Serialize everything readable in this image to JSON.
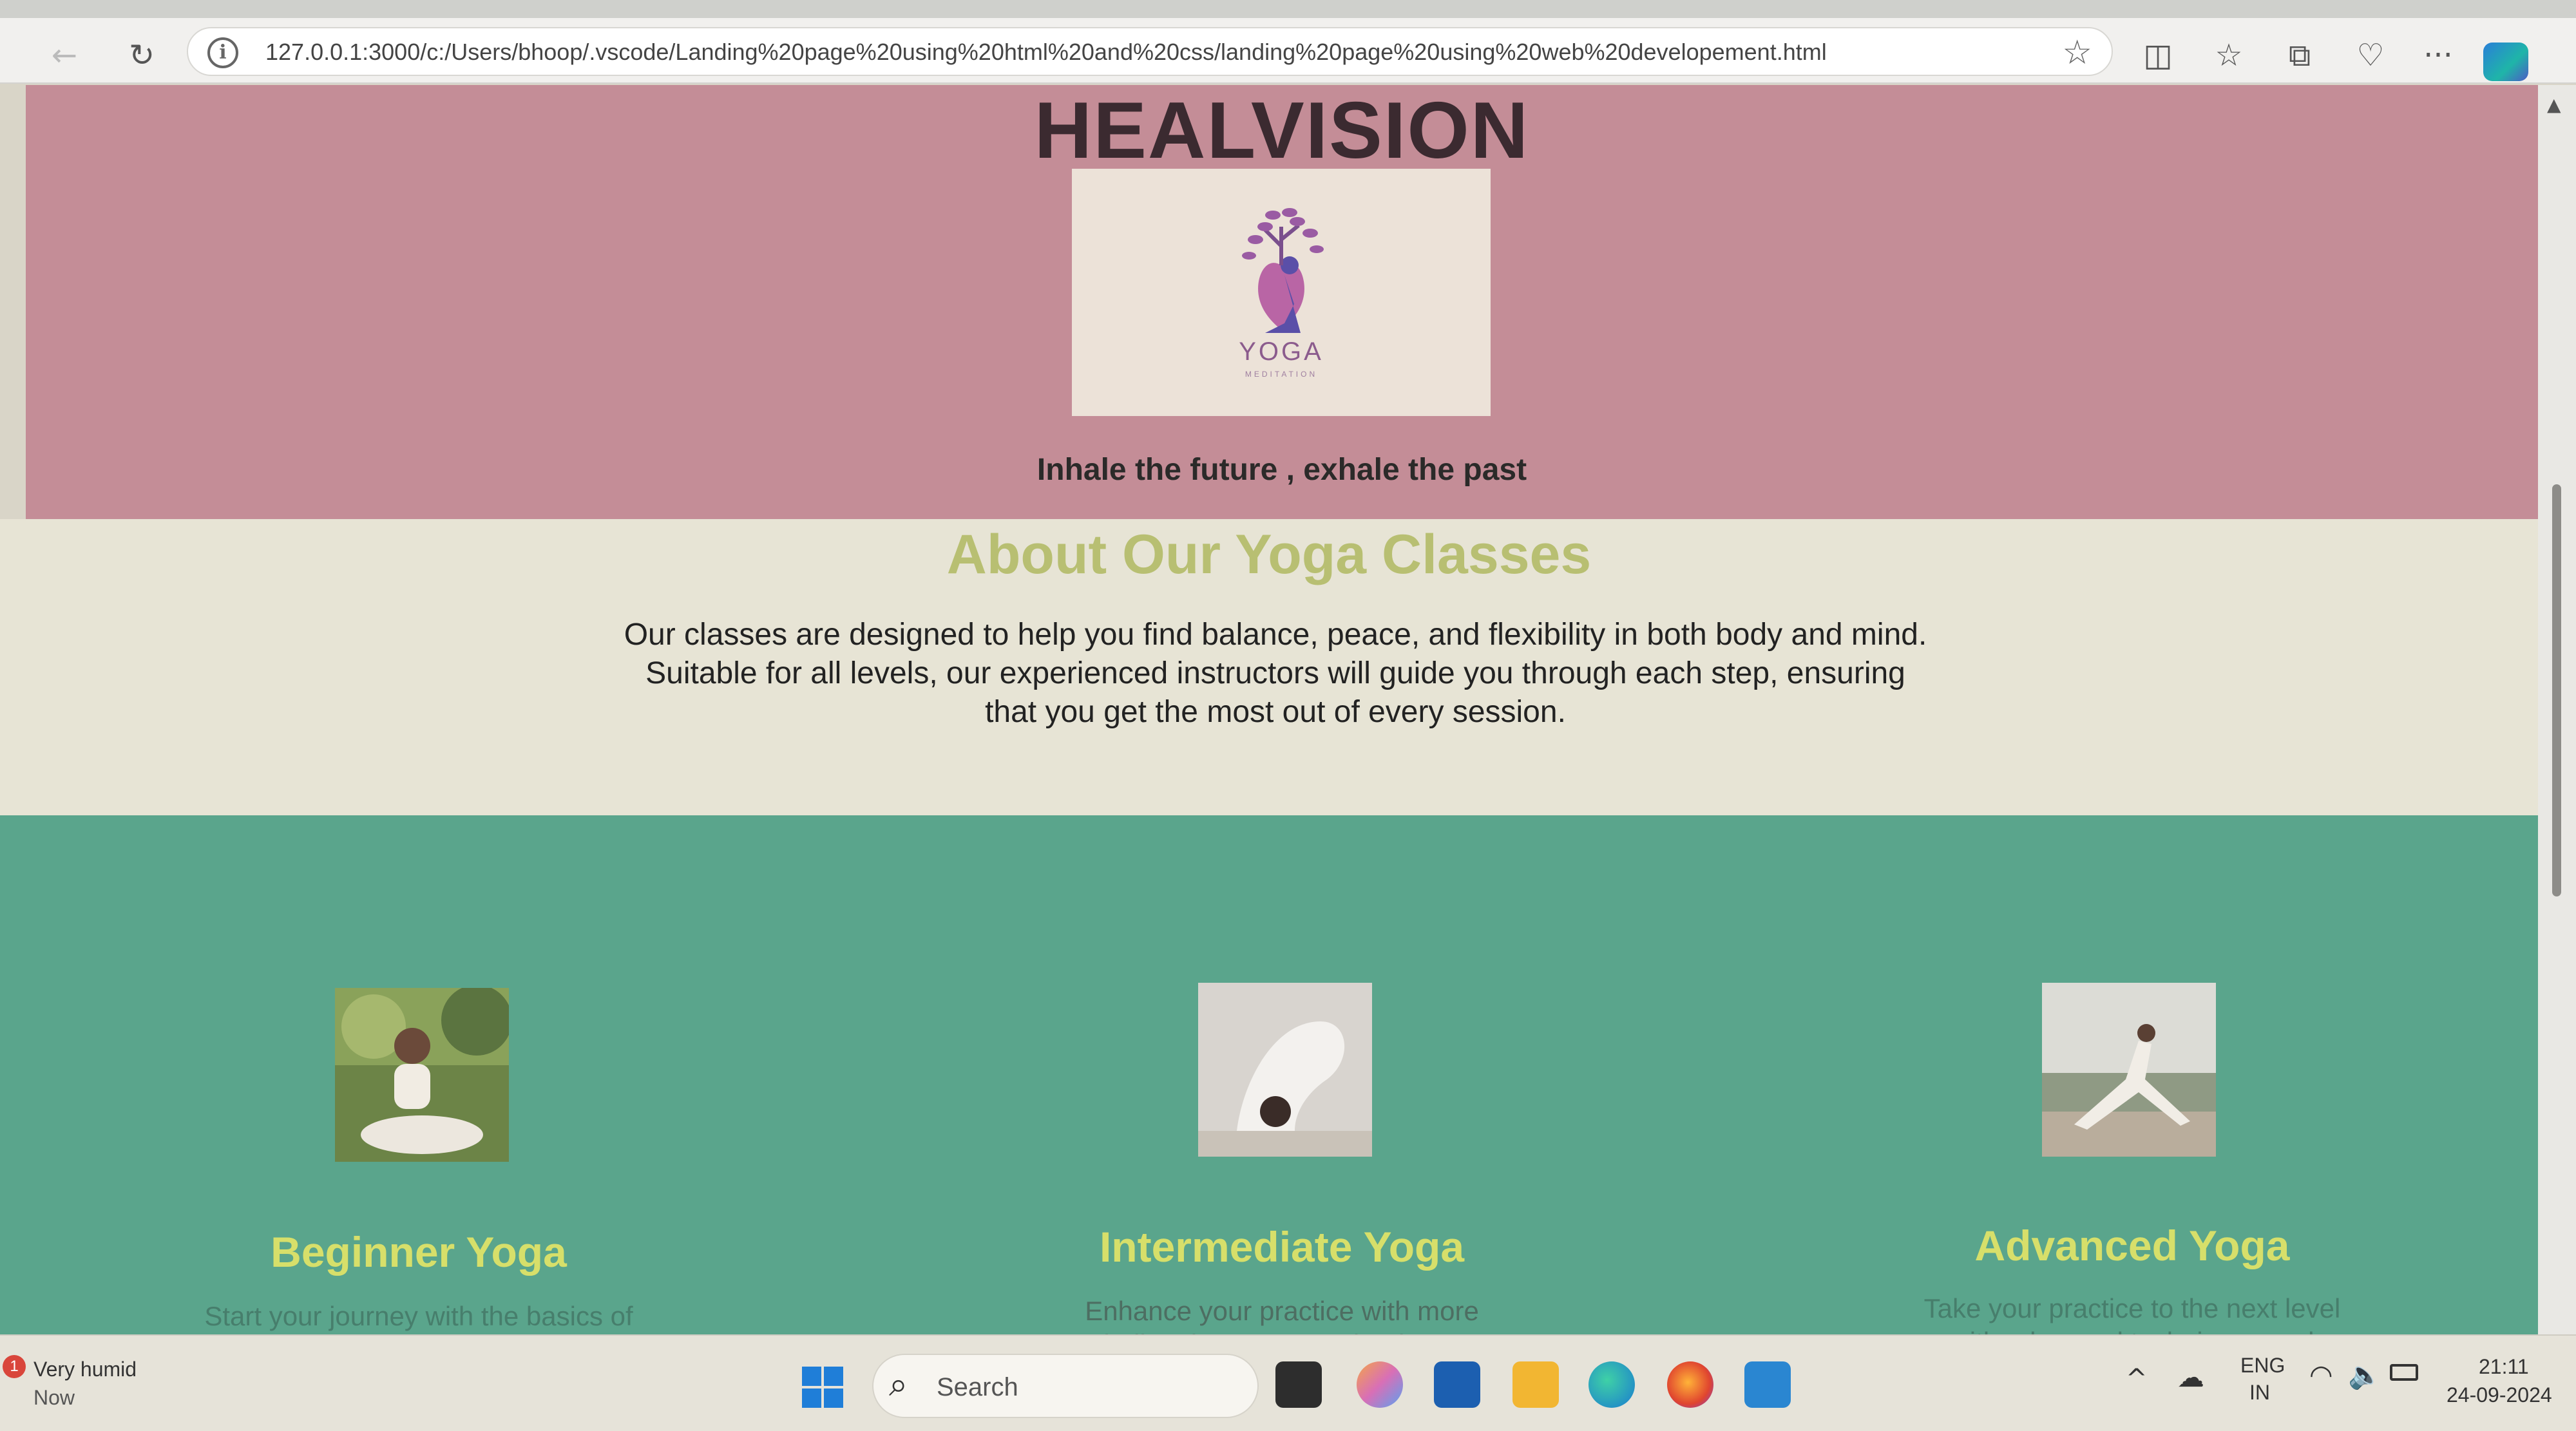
{
  "browser": {
    "url": "127.0.0.1:3000/c:/Users/bhoop/.vscode/Landing%20page%20using%20html%20and%20css/landing%20page%20using%20web%20developement.html",
    "icons": [
      "back-icon",
      "refresh-icon",
      "info-icon",
      "favorite-star-icon",
      "split-screen-icon",
      "favorites-icon",
      "collections-icon",
      "browser-essentials-icon",
      "more-icon",
      "copilot-icon"
    ],
    "back_glyph": "←",
    "refresh_glyph": "↻",
    "info_glyph": "i",
    "star_glyph": "☆",
    "split_glyph": "◫",
    "favorites_glyph": "☆",
    "collections_glyph": "⧉",
    "essentials_glyph": "♡",
    "more_glyph": "···"
  },
  "header": {
    "title": "HEALVISION",
    "logo_text": "YOGA",
    "logo_subtext": "MEDITATION",
    "tagline": "Inhale the future , exhale the past",
    "background": "#c48d97"
  },
  "about": {
    "title": "About Our Yoga Classes",
    "text": "Our classes are designed to help you find balance, peace, and flexibility in both body and mind. Suitable for all levels, our experienced instructors will guide you through each step, ensuring that you get the most out of every session.",
    "title_color": "#b8bf72",
    "background": "#e7e4d5"
  },
  "classes": {
    "background": "#5aa58c",
    "title_color": "#d7df6a",
    "items": [
      {
        "title": "Beginner Yoga",
        "description": "Start your journey with the basics of yoga, focusing on simple postures and breathing techniques."
      },
      {
        "title": "Intermediate Yoga",
        "description": "Enhance your practice with more challenging poses and a deeper understanding of yoga principles."
      },
      {
        "title": "Advanced Yoga",
        "description": "Take your practice to the next level with advanced techniques and meditation practices."
      }
    ]
  },
  "taskbar": {
    "weather_badge": "1",
    "weather": "Very humid",
    "weather_time": "Now",
    "search_placeholder": "Search",
    "search_glyph": "⌕",
    "chevron_glyph": "^",
    "cloud_glyph": "☁",
    "wifi_glyph": "◠",
    "volume_glyph": "🔈",
    "language": "ENG",
    "region": "IN",
    "time": "21:11",
    "date": "24-09-2024",
    "apps": [
      "file-explorer-icon",
      "copilot-app-icon",
      "store-icon",
      "folder-icon",
      "edge-icon",
      "firefox-icon",
      "vscode-icon"
    ]
  }
}
